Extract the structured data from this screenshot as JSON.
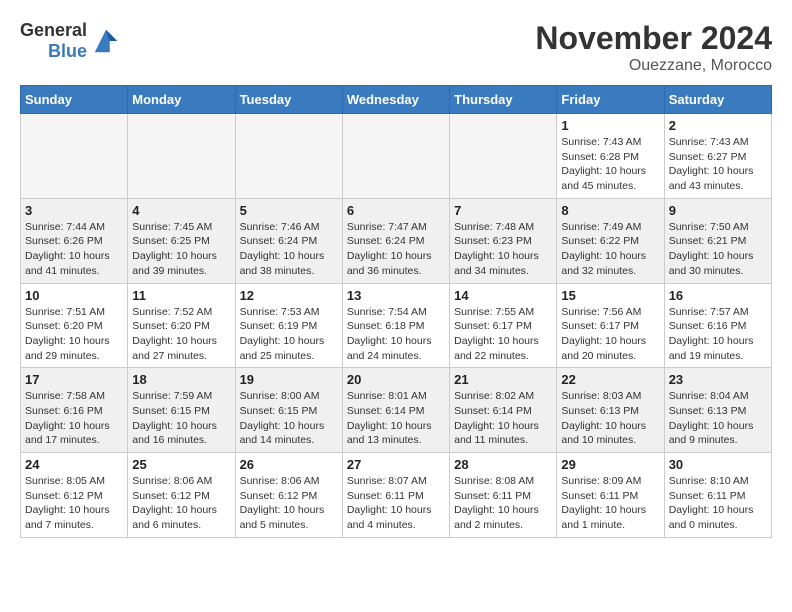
{
  "logo": {
    "text_general": "General",
    "text_blue": "Blue"
  },
  "header": {
    "month": "November 2024",
    "location": "Ouezzane, Morocco"
  },
  "weekdays": [
    "Sunday",
    "Monday",
    "Tuesday",
    "Wednesday",
    "Thursday",
    "Friday",
    "Saturday"
  ],
  "weeks": [
    [
      {
        "day": "",
        "info": "",
        "empty": true
      },
      {
        "day": "",
        "info": "",
        "empty": true
      },
      {
        "day": "",
        "info": "",
        "empty": true
      },
      {
        "day": "",
        "info": "",
        "empty": true
      },
      {
        "day": "",
        "info": "",
        "empty": true
      },
      {
        "day": "1",
        "info": "Sunrise: 7:43 AM\nSunset: 6:28 PM\nDaylight: 10 hours\nand 45 minutes."
      },
      {
        "day": "2",
        "info": "Sunrise: 7:43 AM\nSunset: 6:27 PM\nDaylight: 10 hours\nand 43 minutes."
      }
    ],
    [
      {
        "day": "3",
        "info": "Sunrise: 7:44 AM\nSunset: 6:26 PM\nDaylight: 10 hours\nand 41 minutes."
      },
      {
        "day": "4",
        "info": "Sunrise: 7:45 AM\nSunset: 6:25 PM\nDaylight: 10 hours\nand 39 minutes."
      },
      {
        "day": "5",
        "info": "Sunrise: 7:46 AM\nSunset: 6:24 PM\nDaylight: 10 hours\nand 38 minutes."
      },
      {
        "day": "6",
        "info": "Sunrise: 7:47 AM\nSunset: 6:24 PM\nDaylight: 10 hours\nand 36 minutes."
      },
      {
        "day": "7",
        "info": "Sunrise: 7:48 AM\nSunset: 6:23 PM\nDaylight: 10 hours\nand 34 minutes."
      },
      {
        "day": "8",
        "info": "Sunrise: 7:49 AM\nSunset: 6:22 PM\nDaylight: 10 hours\nand 32 minutes."
      },
      {
        "day": "9",
        "info": "Sunrise: 7:50 AM\nSunset: 6:21 PM\nDaylight: 10 hours\nand 30 minutes."
      }
    ],
    [
      {
        "day": "10",
        "info": "Sunrise: 7:51 AM\nSunset: 6:20 PM\nDaylight: 10 hours\nand 29 minutes."
      },
      {
        "day": "11",
        "info": "Sunrise: 7:52 AM\nSunset: 6:20 PM\nDaylight: 10 hours\nand 27 minutes."
      },
      {
        "day": "12",
        "info": "Sunrise: 7:53 AM\nSunset: 6:19 PM\nDaylight: 10 hours\nand 25 minutes."
      },
      {
        "day": "13",
        "info": "Sunrise: 7:54 AM\nSunset: 6:18 PM\nDaylight: 10 hours\nand 24 minutes."
      },
      {
        "day": "14",
        "info": "Sunrise: 7:55 AM\nSunset: 6:17 PM\nDaylight: 10 hours\nand 22 minutes."
      },
      {
        "day": "15",
        "info": "Sunrise: 7:56 AM\nSunset: 6:17 PM\nDaylight: 10 hours\nand 20 minutes."
      },
      {
        "day": "16",
        "info": "Sunrise: 7:57 AM\nSunset: 6:16 PM\nDaylight: 10 hours\nand 19 minutes."
      }
    ],
    [
      {
        "day": "17",
        "info": "Sunrise: 7:58 AM\nSunset: 6:16 PM\nDaylight: 10 hours\nand 17 minutes."
      },
      {
        "day": "18",
        "info": "Sunrise: 7:59 AM\nSunset: 6:15 PM\nDaylight: 10 hours\nand 16 minutes."
      },
      {
        "day": "19",
        "info": "Sunrise: 8:00 AM\nSunset: 6:15 PM\nDaylight: 10 hours\nand 14 minutes."
      },
      {
        "day": "20",
        "info": "Sunrise: 8:01 AM\nSunset: 6:14 PM\nDaylight: 10 hours\nand 13 minutes."
      },
      {
        "day": "21",
        "info": "Sunrise: 8:02 AM\nSunset: 6:14 PM\nDaylight: 10 hours\nand 11 minutes."
      },
      {
        "day": "22",
        "info": "Sunrise: 8:03 AM\nSunset: 6:13 PM\nDaylight: 10 hours\nand 10 minutes."
      },
      {
        "day": "23",
        "info": "Sunrise: 8:04 AM\nSunset: 6:13 PM\nDaylight: 10 hours\nand 9 minutes."
      }
    ],
    [
      {
        "day": "24",
        "info": "Sunrise: 8:05 AM\nSunset: 6:12 PM\nDaylight: 10 hours\nand 7 minutes."
      },
      {
        "day": "25",
        "info": "Sunrise: 8:06 AM\nSunset: 6:12 PM\nDaylight: 10 hours\nand 6 minutes."
      },
      {
        "day": "26",
        "info": "Sunrise: 8:06 AM\nSunset: 6:12 PM\nDaylight: 10 hours\nand 5 minutes."
      },
      {
        "day": "27",
        "info": "Sunrise: 8:07 AM\nSunset: 6:11 PM\nDaylight: 10 hours\nand 4 minutes."
      },
      {
        "day": "28",
        "info": "Sunrise: 8:08 AM\nSunset: 6:11 PM\nDaylight: 10 hours\nand 2 minutes."
      },
      {
        "day": "29",
        "info": "Sunrise: 8:09 AM\nSunset: 6:11 PM\nDaylight: 10 hours\nand 1 minute."
      },
      {
        "day": "30",
        "info": "Sunrise: 8:10 AM\nSunset: 6:11 PM\nDaylight: 10 hours\nand 0 minutes."
      }
    ]
  ]
}
